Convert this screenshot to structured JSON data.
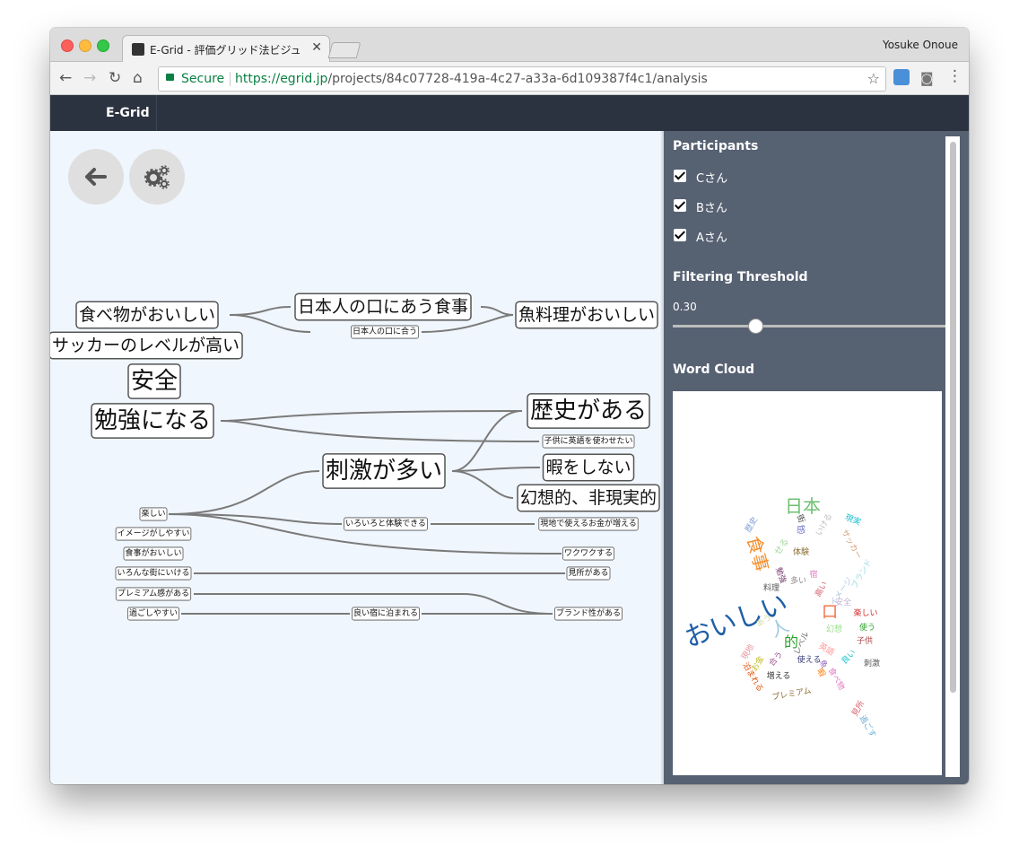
{
  "browser": {
    "tab_title": "E-Grid - 評価グリッド法ビジュ",
    "profile": "Yosuke Onoue",
    "secure_label": "Secure",
    "url_scheme": "https://",
    "url_host": "egrid.jp",
    "url_path": "/projects/84c07728-419a-4c27-a33a-6d109387f4c1/analysis"
  },
  "app": {
    "brand": "E-Grid"
  },
  "canvas": {
    "back_button": "back-arrow-icon",
    "settings_button": "gears-icon",
    "nodes": [
      {
        "text": "食べ物がおいしい"
      },
      {
        "text": "日本人の口にあう食事"
      },
      {
        "text": "魚料理がおいしい"
      },
      {
        "text": "日本人の口に合う"
      },
      {
        "text": "サッカーのレベルが高い"
      },
      {
        "text": "安全"
      },
      {
        "text": "勉強になる"
      },
      {
        "text": "歴史がある"
      },
      {
        "text": "子供に英語を使わせたい"
      },
      {
        "text": "刺激が多い"
      },
      {
        "text": "暇をしない"
      },
      {
        "text": "幻想的、非現実的"
      },
      {
        "text": "楽しい"
      },
      {
        "text": "イメージがしやすい"
      },
      {
        "text": "食事がおいしい"
      },
      {
        "text": "いろんな街にいける"
      },
      {
        "text": "プレミアム感がある"
      },
      {
        "text": "過ごしやすい"
      },
      {
        "text": "いろいろと体験できる"
      },
      {
        "text": "現地で使えるお金が増える"
      },
      {
        "text": "ワクワクする"
      },
      {
        "text": "見所がある"
      },
      {
        "text": "良い宿に泊まれる"
      },
      {
        "text": "ブランド性がある"
      }
    ]
  },
  "sidebar": {
    "participants_heading": "Participants",
    "participants": [
      {
        "label": "Cさん",
        "checked": true
      },
      {
        "label": "Bさん",
        "checked": true
      },
      {
        "label": "Aさん",
        "checked": true
      }
    ],
    "threshold_heading": "Filtering Threshold",
    "threshold_value": "0.30",
    "threshold_fraction": 0.3,
    "wordcloud_heading": "Word Cloud",
    "words": [
      {
        "text": "日本",
        "color": "#6cc070"
      },
      {
        "text": "食事",
        "color": "#f28e2b"
      },
      {
        "text": "おいしい",
        "color": "#1f5fa8"
      },
      {
        "text": "人",
        "color": "#9ecae1"
      },
      {
        "text": "口",
        "color": "#f46d43"
      },
      {
        "text": "的",
        "color": "#2ca02c"
      },
      {
        "text": "歴史",
        "color": "#7f9fd6"
      },
      {
        "text": "せる",
        "color": "#a1d99b"
      },
      {
        "text": "感",
        "color": "#6b6ecf"
      },
      {
        "text": "街",
        "color": "#444444"
      },
      {
        "text": "体験",
        "color": "#8c6d31"
      },
      {
        "text": "いける",
        "color": "#bbbbbb"
      },
      {
        "text": "現実",
        "color": "#17becf"
      },
      {
        "text": "サッカー",
        "color": "#d59f78"
      },
      {
        "text": "ブランド",
        "color": "#9edae5"
      },
      {
        "text": "イメージ",
        "color": "#aec7e8"
      },
      {
        "text": "料理",
        "color": "#555555"
      },
      {
        "text": "勉強",
        "color": "#7b4173"
      },
      {
        "text": "多い",
        "color": "#888888"
      },
      {
        "text": "高い",
        "color": "#d6616b"
      },
      {
        "text": "宿",
        "color": "#e377c2"
      },
      {
        "text": "安全",
        "color": "#c5b0d5"
      },
      {
        "text": "楽しい",
        "color": "#d62728"
      },
      {
        "text": "幻想",
        "color": "#98df8a"
      },
      {
        "text": "使う",
        "color": "#2ca02c"
      },
      {
        "text": "子供",
        "color": "#ad494a"
      },
      {
        "text": "レベル",
        "color": "#666666"
      },
      {
        "text": "英語",
        "color": "#ff9896"
      },
      {
        "text": "良い",
        "color": "#17becf"
      },
      {
        "text": "刺激",
        "color": "#555555"
      },
      {
        "text": "現地",
        "color": "#e7969c"
      },
      {
        "text": "お金",
        "color": "#bcbd22"
      },
      {
        "text": "合う",
        "color": "#a55194"
      },
      {
        "text": "使える",
        "color": "#393b79"
      },
      {
        "text": "泊まれる",
        "color": "#e6550d"
      },
      {
        "text": "増える",
        "color": "#333333"
      },
      {
        "text": "プレミアム",
        "color": "#8c6d31"
      },
      {
        "text": "食べ物",
        "color": "#e377c2"
      },
      {
        "text": "暇",
        "color": "#ff7f0e"
      },
      {
        "text": "見所",
        "color": "#d6616b"
      },
      {
        "text": "過ごす",
        "color": "#6baed6"
      },
      {
        "text": "あう",
        "color": "#cedb9c"
      },
      {
        "text": "魚",
        "color": "#9467bd"
      }
    ]
  }
}
